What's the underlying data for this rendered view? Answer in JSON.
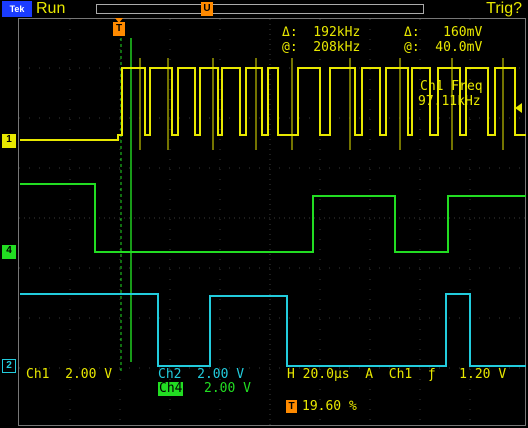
{
  "header": {
    "brand": "Tek",
    "state": "Run",
    "trigger_status": "Trig?",
    "record_marker": "U"
  },
  "trigger_marker": "T",
  "measurements": {
    "delta_freq": "Δ:  192kHz",
    "at_freq": "@:  208kHz",
    "delta_volt": "Δ:   160mV",
    "at_volt": "@:  40.0mV",
    "ch1_freq_label": "Ch1 Freq",
    "ch1_freq_value": "97.11kHz"
  },
  "channels": {
    "ch1_marker": "1",
    "ch4_marker": "4",
    "ch2_marker": "2"
  },
  "status_bar": {
    "ch1": "Ch1  2.00 V",
    "ch2": "Ch2  2.00 V",
    "ch4_label": "Ch4",
    "ch4_value": "2.00 V",
    "timebase": "H 20.0µs  A  Ch1  ƒ   1.20 V",
    "trigger_pos": "19.60 %"
  },
  "colors": {
    "ch1": "#e8e800",
    "ch4": "#22dd22",
    "ch2": "#22ccdd",
    "accent": "#ff8a00"
  }
}
